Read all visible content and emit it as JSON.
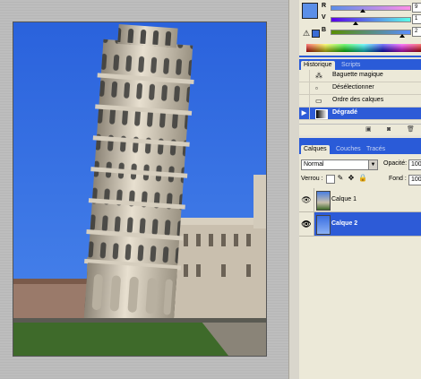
{
  "color_panel": {
    "channels": [
      {
        "label": "R",
        "value": "9"
      },
      {
        "label": "V",
        "value": "1"
      },
      {
        "label": "B",
        "value": "2"
      }
    ],
    "foreground": "#5b8fe8",
    "background": "#2860d0"
  },
  "history": {
    "tabs": [
      {
        "label": "Historique",
        "active": true
      },
      {
        "label": "Scripts",
        "active": false
      }
    ],
    "items": [
      {
        "label": "Baguette magique",
        "icon": "magic-wand-icon"
      },
      {
        "label": "Désélectionner",
        "icon": "deselect-icon"
      },
      {
        "label": "Ordre des calques",
        "icon": "layer-order-icon"
      },
      {
        "label": "Dégradé",
        "icon": "gradient-icon",
        "selected": true
      }
    ]
  },
  "layers": {
    "tabs": [
      {
        "label": "Calques",
        "active": true
      },
      {
        "label": "Couches",
        "active": false
      },
      {
        "label": "Tracés",
        "active": false
      }
    ],
    "blend_mode": "Normal",
    "opacity_label": "Opacité:",
    "opacity_value": "100",
    "lock_label": "Verrou :",
    "fill_label": "Fond :",
    "fill_value": "100",
    "items": [
      {
        "name": "Calque 1",
        "selected": false
      },
      {
        "name": "Calque 2",
        "selected": true
      }
    ]
  },
  "accent": "#2d5bd7"
}
